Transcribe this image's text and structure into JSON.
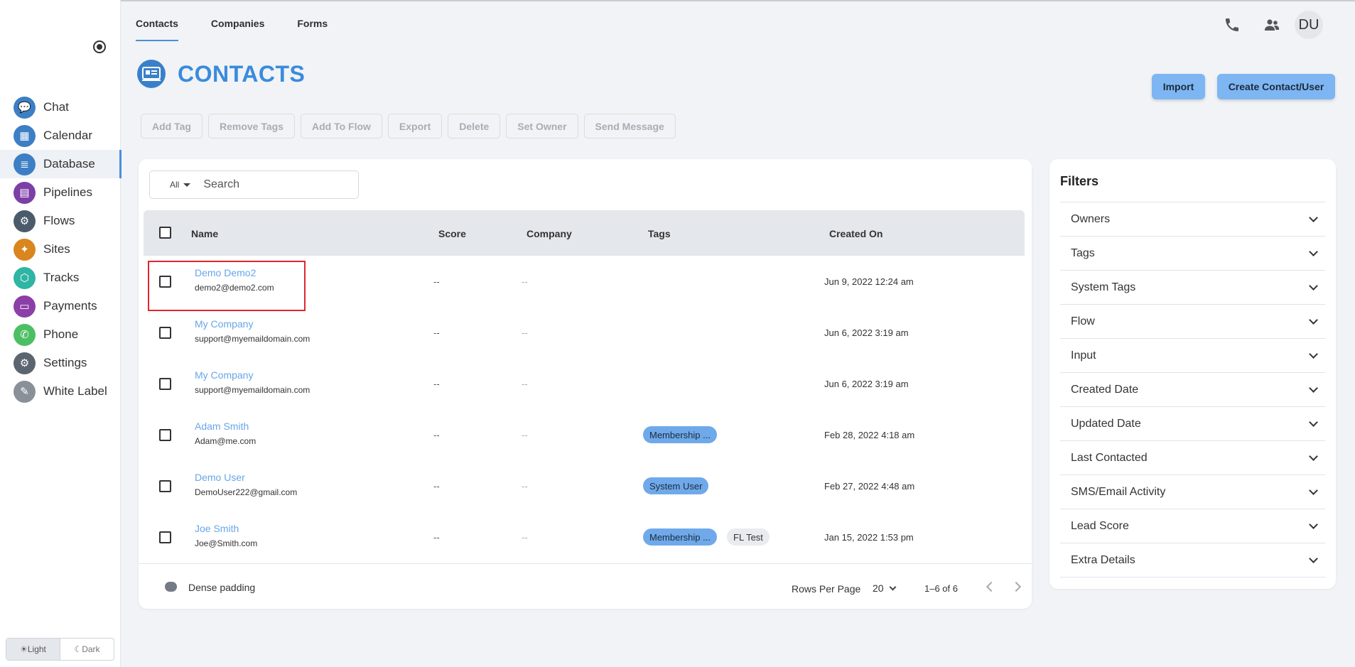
{
  "sidebar": {
    "items": [
      {
        "label": "Chat",
        "icon": "chat-icon",
        "color": "#3d7fc4"
      },
      {
        "label": "Calendar",
        "icon": "calendar-icon",
        "color": "#3d7fc4"
      },
      {
        "label": "Database",
        "icon": "database-icon",
        "color": "#3d7fc4"
      },
      {
        "label": "Pipelines",
        "icon": "clipboard-icon",
        "color": "#7b3fa6"
      },
      {
        "label": "Flows",
        "icon": "flows-gear-icon",
        "color": "#4b5b6b"
      },
      {
        "label": "Sites",
        "icon": "lightbulb-icon",
        "color": "#d9861f"
      },
      {
        "label": "Tracks",
        "icon": "tracks-icon",
        "color": "#2fb5a3"
      },
      {
        "label": "Payments",
        "icon": "credit-card-icon",
        "color": "#8c3fa6"
      },
      {
        "label": "Phone",
        "icon": "phone-icon",
        "color": "#4cbf63"
      },
      {
        "label": "Settings",
        "icon": "settings-gear-icon",
        "color": "#5b6570"
      },
      {
        "label": "White Label",
        "icon": "brush-icon",
        "color": "#8a9099"
      }
    ],
    "theme": {
      "light": "Light",
      "dark": "Dark"
    }
  },
  "tabs": [
    "Contacts",
    "Companies",
    "Forms"
  ],
  "header": {
    "avatar": "DU",
    "title": "CONTACTS"
  },
  "actions": {
    "import": "Import",
    "create": "Create Contact/User"
  },
  "bulk": [
    "Add Tag",
    "Remove Tags",
    "Add To Flow",
    "Export",
    "Delete",
    "Set Owner",
    "Send Message"
  ],
  "search": {
    "scope": "All",
    "placeholder": "Search"
  },
  "table": {
    "columns": {
      "name": "Name",
      "score": "Score",
      "company": "Company",
      "tags": "Tags",
      "created": "Created On"
    },
    "rows": [
      {
        "name": "Demo Demo2",
        "email": "demo2@demo2.com",
        "score": "--",
        "company": "--",
        "tags": [],
        "created": "Jun 9, 2022 12:24 am"
      },
      {
        "name": "My Company",
        "email": "support@myemaildomain.com",
        "score": "--",
        "company": "--",
        "tags": [],
        "created": "Jun 6, 2022 3:19 am"
      },
      {
        "name": "My Company",
        "email": "support@myemaildomain.com",
        "score": "--",
        "company": "--",
        "tags": [],
        "created": "Jun 6, 2022 3:19 am"
      },
      {
        "name": "Adam Smith",
        "email": "Adam@me.com",
        "score": "--",
        "company": "--",
        "tags": [
          "Membership ..."
        ],
        "created": "Feb 28, 2022 4:18 am"
      },
      {
        "name": "Demo User",
        "email": "DemoUser222@gmail.com",
        "score": "--",
        "company": "--",
        "tags": [
          "System User"
        ],
        "created": "Feb 27, 2022 4:48 am"
      },
      {
        "name": "Joe Smith",
        "email": "Joe@Smith.com",
        "score": "--",
        "company": "--",
        "tags": [
          "Membership ...",
          "FL Test"
        ],
        "created": "Jan 15, 2022 1:53 pm"
      }
    ],
    "footer": {
      "dense": "Dense padding",
      "rows_per_page_label": "Rows Per Page",
      "rows_per_page": "20",
      "range": "1–6 of 6"
    }
  },
  "filters": {
    "title": "Filters",
    "items": [
      "Owners",
      "Tags",
      "System Tags",
      "Flow",
      "Input",
      "Created Date",
      "Updated Date",
      "Last Contacted",
      "SMS/Email Activity",
      "Lead Score",
      "Extra Details"
    ]
  },
  "colors": {
    "accent": "#4a90d9",
    "title": "#3a8bdc",
    "link": "#67a6e8",
    "primary_button": "#7eb6f3",
    "tag_blue": "#6fa9ea",
    "highlight": "#e0262e"
  }
}
